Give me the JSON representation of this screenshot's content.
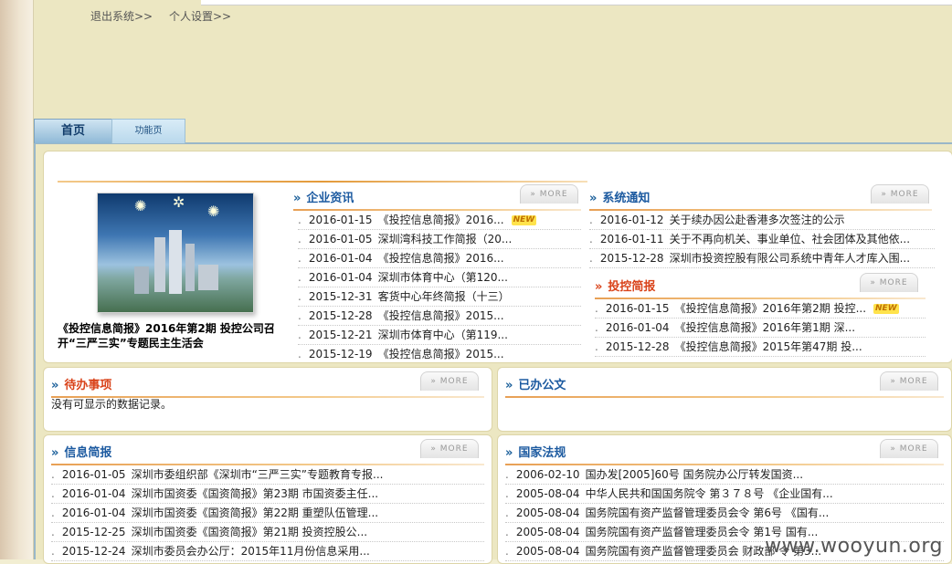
{
  "top_links": {
    "logout": "退出系统>>",
    "settings": "个人设置>>"
  },
  "tabs": {
    "home": "首页",
    "function": "功能页"
  },
  "feature": {
    "caption": "《投控信息简报》2016年第2期 投控公司召开“三严三实”专题民主生活会"
  },
  "more_label": "» MORE",
  "new_label": "NEW",
  "enterprise_news": {
    "title": "企业资讯",
    "items": [
      {
        "date": "2016-01-15",
        "text": "《投控信息简报》2016...",
        "is_new": true
      },
      {
        "date": "2016-01-05",
        "text": "深圳湾科技工作简报（20..."
      },
      {
        "date": "2016-01-04",
        "text": "《投控信息简报》2016..."
      },
      {
        "date": "2016-01-04",
        "text": "深圳市体育中心（第120..."
      },
      {
        "date": "2015-12-31",
        "text": "客货中心年终简报（十三）"
      },
      {
        "date": "2015-12-28",
        "text": "《投控信息简报》2015..."
      },
      {
        "date": "2015-12-21",
        "text": "深圳市体育中心（第119..."
      },
      {
        "date": "2015-12-19",
        "text": "《投控信息简报》2015..."
      }
    ]
  },
  "system_notice": {
    "title": "系统通知",
    "items": [
      {
        "date": "2016-01-12",
        "text": "关于续办因公赴香港多次签注的公示"
      },
      {
        "date": "2016-01-11",
        "text": "关于不再向机关、事业单位、社会团体及其他依..."
      },
      {
        "date": "2015-12-28",
        "text": "深圳市投资控股有限公司系统中青年人才库入围..."
      }
    ]
  },
  "investment_bulletin": {
    "title": "投控简报",
    "items": [
      {
        "date": "2016-01-15",
        "text": "《投控信息简报》2016年第2期 投控...",
        "is_new": true
      },
      {
        "date": "2016-01-04",
        "text": "《投控信息简报》2016年第1期 深..."
      },
      {
        "date": "2015-12-28",
        "text": "《投控信息简报》2015年第47期 投..."
      }
    ]
  },
  "todo": {
    "title": "待办事项",
    "empty_text": "没有可显示的数据记录。"
  },
  "done_docs": {
    "title": "已办公文"
  },
  "info_bulletin": {
    "title": "信息简报",
    "items": [
      {
        "date": "2016-01-05",
        "text": "深圳市委组织部《深圳市“三严三实”专题教育专报..."
      },
      {
        "date": "2016-01-04",
        "text": "深圳市国资委《国资简报》第23期 市国资委主任..."
      },
      {
        "date": "2016-01-04",
        "text": "深圳市国资委《国资简报》第22期 重塑队伍管理..."
      },
      {
        "date": "2015-12-25",
        "text": "深圳市国资委《国资简报》第21期 投资控股公..."
      },
      {
        "date": "2015-12-24",
        "text": "深圳市委员会办公厅：2015年11月份信息采用..."
      }
    ]
  },
  "national_law": {
    "title": "国家法规",
    "items": [
      {
        "date": "2006-02-10",
        "text": "国办发[2005]60号 国务院办公厅转发国资..."
      },
      {
        "date": "2005-08-04",
        "text": "中华人民共和国国务院令 第３７８号 《企业国有..."
      },
      {
        "date": "2005-08-04",
        "text": "国务院国有资产监督管理委员会令 第6号 《国有..."
      },
      {
        "date": "2005-08-04",
        "text": "国务院国有资产监督管理委员会令 第1号 国有..."
      },
      {
        "date": "2005-08-04",
        "text": "国务院国有资产监督管理委员会 财政部 令 第3..."
      }
    ]
  },
  "watermark": "www.wooyun.org"
}
